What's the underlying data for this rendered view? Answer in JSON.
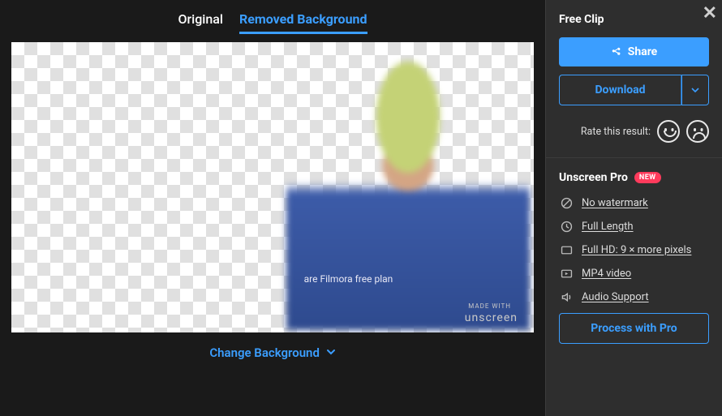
{
  "tabs": {
    "original": "Original",
    "removed": "Removed Background"
  },
  "watermark": {
    "line": "are Filmora free plan",
    "made": "MADE WITH",
    "brand": "unscreen"
  },
  "changeBg": "Change Background",
  "side": {
    "freeClip": "Free Clip",
    "share": "Share",
    "download": "Download",
    "rateLabel": "Rate this result:",
    "proTitle": "Unscreen Pro",
    "badge": "NEW",
    "features": {
      "noWatermark": "No watermark",
      "fullLength": "Full Length",
      "fullHd": "Full HD: 9 × more pixels",
      "mp4": "MP4 video",
      "audio": "Audio Support"
    },
    "processPro": "Process with Pro"
  }
}
